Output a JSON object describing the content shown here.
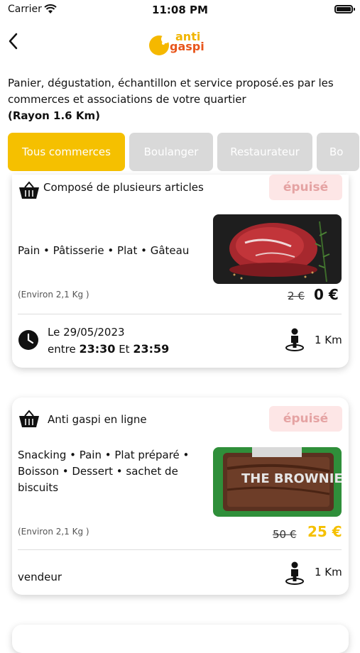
{
  "status_bar": {
    "carrier": "Carrier",
    "time": "11:08 PM"
  },
  "header": {
    "logo_line1": "anti",
    "logo_line2": "gaspi"
  },
  "intro": {
    "text": "Panier, dégustation, échantillon et service proposé.es par les commerces et associations de votre quartier",
    "radius": "(Rayon 1.6 Km)"
  },
  "filters": [
    {
      "label": "Tous commerces",
      "active": true
    },
    {
      "label": "Boulanger",
      "active": false
    },
    {
      "label": "Restaurateur",
      "active": false
    },
    {
      "label": "Bo",
      "active": false
    }
  ],
  "offers": [
    {
      "title": "Composé de plusieurs articles",
      "badge": "épuisé",
      "tags": "Pain  • Pâtisserie • Plat • Gâteau",
      "weight": "(Environ 2,1 Kg )",
      "old_price": "2 €",
      "new_price": "0 €",
      "price_color": "#111111",
      "pickup_date": "Le 29/05/2023",
      "pickup_between": "entre",
      "pickup_from": "23:30",
      "pickup_and": "Et",
      "pickup_to": "23:59",
      "distance": "1 Km"
    },
    {
      "title": "Anti gaspi en ligne",
      "badge": "épuisé",
      "tags": "Snacking  • Pain • Plat préparé • Boisson • Dessert • sachet de biscuits",
      "weight": "(Environ 2,1 Kg )",
      "old_price": "50 €",
      "new_price": "25 €",
      "price_color": "#f5c000",
      "vendor": "vendeur",
      "distance": "1 Km",
      "image_text": "THE BROWNIE"
    }
  ]
}
